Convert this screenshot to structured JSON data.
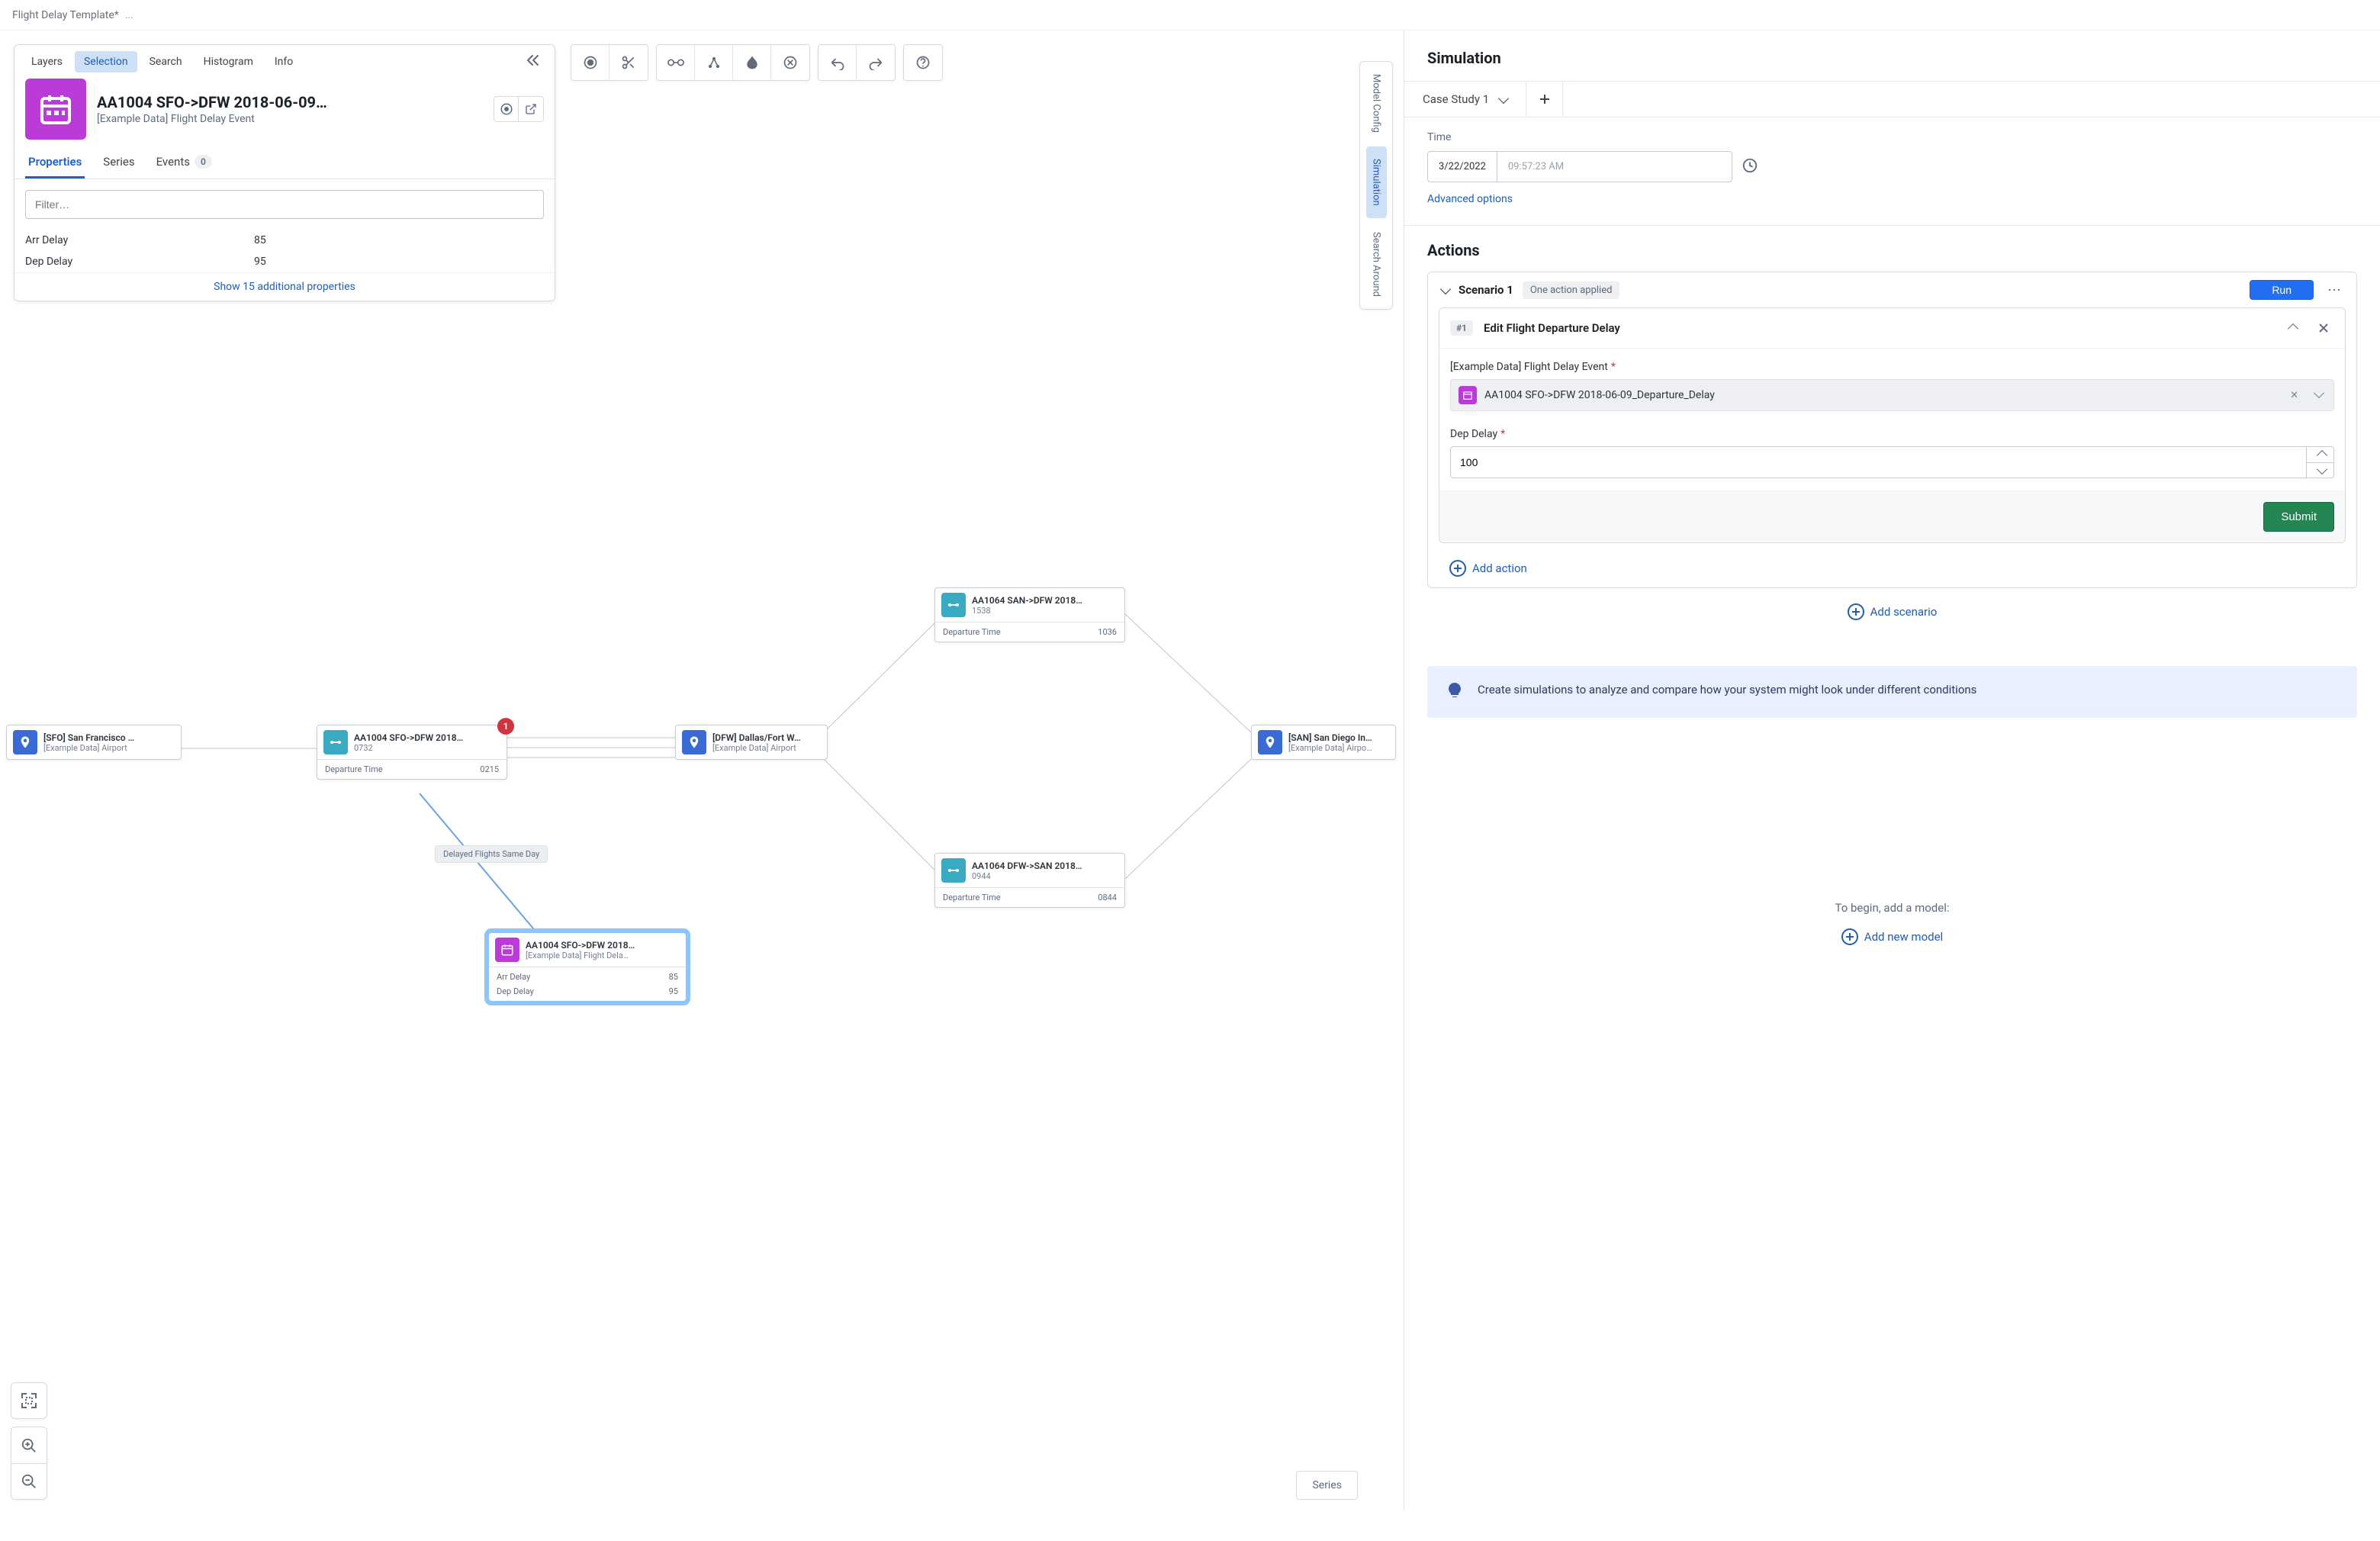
{
  "titlebar": {
    "text": "Flight Delay Template*",
    "more": "..."
  },
  "left_panel": {
    "tabs": [
      "Layers",
      "Selection",
      "Search",
      "Histogram",
      "Info"
    ],
    "active_tab": "Selection",
    "header": {
      "title": "AA1004 SFO->DFW 2018-06-09…",
      "subtitle": "[Example Data] Flight Delay Event"
    },
    "subtabs": {
      "properties": "Properties",
      "series": "Series",
      "events": "Events",
      "events_count": "0"
    },
    "filter_placeholder": "Filter…",
    "properties": [
      {
        "key": "Arr Delay",
        "value": "85"
      },
      {
        "key": "Dep Delay",
        "value": "95"
      }
    ],
    "show_more": "Show 15 additional properties"
  },
  "bottom": {
    "series_btn": "Series"
  },
  "side_tabs": {
    "model": "Model Config",
    "simulation": "Simulation",
    "search": "Search Around"
  },
  "nodes": {
    "sfo": {
      "title": "[SFO] San Francisco …",
      "sub": "[Example Data] Airport"
    },
    "f1": {
      "title": "AA1004 SFO->DFW 2018…",
      "sub": "0732",
      "ft_key": "Departure Time",
      "ft_val": "0215",
      "badge": "1"
    },
    "dfw": {
      "title": "[DFW] Dallas/Fort W…",
      "sub": "[Example Data] Airport"
    },
    "f2": {
      "title": "AA1064 SAN->DFW 2018…",
      "sub": "1538",
      "ft_key": "Departure Time",
      "ft_val": "1036"
    },
    "f3": {
      "title": "AA1064 DFW->SAN 2018…",
      "sub": "0944",
      "ft_key": "Departure Time",
      "ft_val": "0844"
    },
    "san": {
      "title": "[SAN] San Diego In…",
      "sub": "[Example Data] Airpo…"
    },
    "sel": {
      "title": "AA1004 SFO->DFW 2018…",
      "sub": "[Example Data] Flight Dela…",
      "r1k": "Arr Delay",
      "r1v": "85",
      "r2k": "Dep Delay",
      "r2v": "95"
    },
    "edge_label": "Delayed Flights Same Day"
  },
  "right": {
    "simulation_title": "Simulation",
    "case_tab": "Case Study 1",
    "time_label": "Time",
    "date": "3/22/2022",
    "time": "09:57:23 AM",
    "adv": "Advanced options",
    "actions_title": "Actions",
    "scenario": {
      "name": "Scenario 1",
      "badge": "One action applied",
      "run": "Run",
      "action": {
        "num": "#1",
        "title": "Edit Flight Departure Delay",
        "field1_label": "[Example Data] Flight Delay Event",
        "field1_value": "AA1004 SFO->DFW 2018-06-09_Departure_Delay",
        "field2_label": "Dep Delay",
        "field2_value": "100",
        "submit": "Submit"
      },
      "add_action": "Add action"
    },
    "add_scenario": "Add scenario",
    "callout": "Create simulations to analyze and compare how your system might look under different conditions",
    "model_prompt": "To begin, add a model:",
    "add_model": "Add new model"
  }
}
